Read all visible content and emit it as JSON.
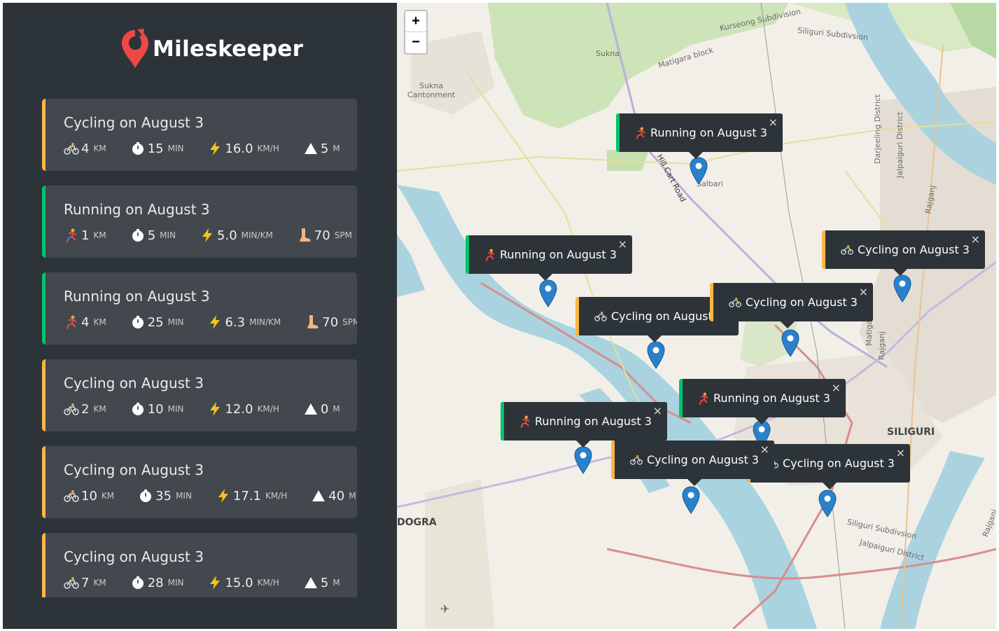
{
  "app": {
    "name": "Mileskeeper"
  },
  "workouts": [
    {
      "title": "Cycling on August 3",
      "type": "cycling",
      "stats": [
        {
          "icon": "bike-icon",
          "value": "4",
          "unit": "KM"
        },
        {
          "icon": "stopwatch-icon",
          "value": "15",
          "unit": "MIN"
        },
        {
          "icon": "lightning-icon",
          "value": "16.0",
          "unit": "KM/H"
        },
        {
          "icon": "mountain-icon",
          "value": "5",
          "unit": "M"
        }
      ]
    },
    {
      "title": "Running on August 3",
      "type": "running",
      "stats": [
        {
          "icon": "runner-icon",
          "value": "1",
          "unit": "KM"
        },
        {
          "icon": "stopwatch-icon",
          "value": "5",
          "unit": "MIN"
        },
        {
          "icon": "lightning-icon",
          "value": "5.0",
          "unit": "MIN/KM"
        },
        {
          "icon": "foot-icon",
          "value": "70",
          "unit": "SPM"
        }
      ]
    },
    {
      "title": "Running on August 3",
      "type": "running",
      "stats": [
        {
          "icon": "runner-icon",
          "value": "4",
          "unit": "KM"
        },
        {
          "icon": "stopwatch-icon",
          "value": "25",
          "unit": "MIN"
        },
        {
          "icon": "lightning-icon",
          "value": "6.3",
          "unit": "MIN/KM"
        },
        {
          "icon": "foot-icon",
          "value": "70",
          "unit": "SPM"
        }
      ]
    },
    {
      "title": "Cycling on August 3",
      "type": "cycling",
      "stats": [
        {
          "icon": "bike-icon",
          "value": "2",
          "unit": "KM"
        },
        {
          "icon": "stopwatch-icon",
          "value": "10",
          "unit": "MIN"
        },
        {
          "icon": "lightning-icon",
          "value": "12.0",
          "unit": "KM/H"
        },
        {
          "icon": "mountain-icon",
          "value": "0",
          "unit": "M"
        }
      ]
    },
    {
      "title": "Cycling on August 3",
      "type": "cycling",
      "stats": [
        {
          "icon": "bike-icon",
          "value": "10",
          "unit": "KM"
        },
        {
          "icon": "stopwatch-icon",
          "value": "35",
          "unit": "MIN"
        },
        {
          "icon": "lightning-icon",
          "value": "17.1",
          "unit": "KM/H"
        },
        {
          "icon": "mountain-icon",
          "value": "40",
          "unit": "M"
        }
      ]
    },
    {
      "title": "Cycling on August 3",
      "type": "cycling",
      "stats": [
        {
          "icon": "bike-icon",
          "value": "7",
          "unit": "KM"
        },
        {
          "icon": "stopwatch-icon",
          "value": "28",
          "unit": "MIN"
        },
        {
          "icon": "lightning-icon",
          "value": "15.0",
          "unit": "KM/H"
        },
        {
          "icon": "mountain-icon",
          "value": "5",
          "unit": "M"
        }
      ]
    }
  ],
  "map": {
    "zoom_in": "+",
    "zoom_out": "−",
    "close_symbol": "×",
    "labels": [
      "Kurseong Subdivision",
      "Siliguri Subdivsion",
      "Sukna",
      "Matigara block",
      "Sukna Cantonment",
      "Darjeeling District",
      "Jalpaiguri District",
      "Rajganj",
      "SILIGURI",
      "DOGRA",
      "Siliguri Subdivsion",
      "Jalpaiguri District",
      "Rajganj",
      "Matigara",
      "Rajganj",
      "Hill Cart Road",
      "Salbari"
    ],
    "popups": [
      {
        "text": "Running on August 3",
        "type": "running"
      },
      {
        "text": "Running on August 3",
        "type": "running"
      },
      {
        "text": "Cycling on August 3",
        "type": "cycling"
      },
      {
        "text": "Cycling on August",
        "type": "cycling"
      },
      {
        "text": "Cycling on August 3",
        "type": "cycling"
      },
      {
        "text": "Running on August 3",
        "type": "running"
      },
      {
        "text": "Running on August 3",
        "type": "running"
      },
      {
        "text": "Cycling on August 3",
        "type": "cycling"
      },
      {
        "text": "Cycling on August 3",
        "type": "cycling"
      }
    ]
  },
  "colors": {
    "cycling": "#ffb545",
    "running": "#00c46a",
    "sidebar": "#2d3439",
    "card": "#42484e",
    "marker": "#2a81cb",
    "logo": "#f04848"
  }
}
